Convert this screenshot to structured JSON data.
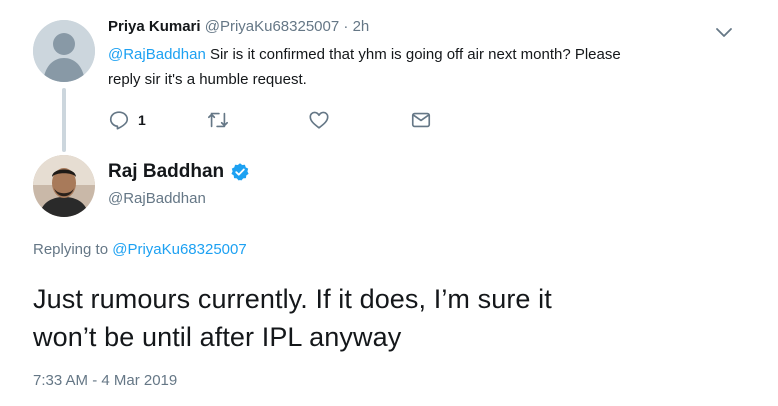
{
  "parent_tweet": {
    "author_name": "Priya Kumari",
    "author_handle": "@PriyaKu68325007",
    "separator": "·",
    "time": "2h",
    "mention": "@RajBaddhan",
    "text_line1": " Sir is it confirmed that yhm is going off air next month? Please",
    "text_line2": "reply sir it's a humble request.",
    "reply_count": "1",
    "icons": {
      "menu": "chevron-down-icon",
      "reply": "reply-icon",
      "retweet": "retweet-icon",
      "like": "heart-icon",
      "message": "envelope-icon"
    }
  },
  "focal_tweet": {
    "author_name": "Raj Baddhan",
    "author_handle": "@RajBaddhan",
    "verified": true,
    "replying_to_label": "Replying to ",
    "replying_to_handle": "@PriyaKu68325007",
    "text_line1": "Just rumours currently. If it does, I’m sure it",
    "text_line2": "won’t be until after IPL anyway",
    "timestamp": "7:33 AM - 4 Mar 2019"
  },
  "colors": {
    "link": "#1da1f2",
    "secondary_text": "#657786",
    "primary_text": "#14171a",
    "thread_line": "#ccd6dd",
    "icon": "#657786"
  }
}
